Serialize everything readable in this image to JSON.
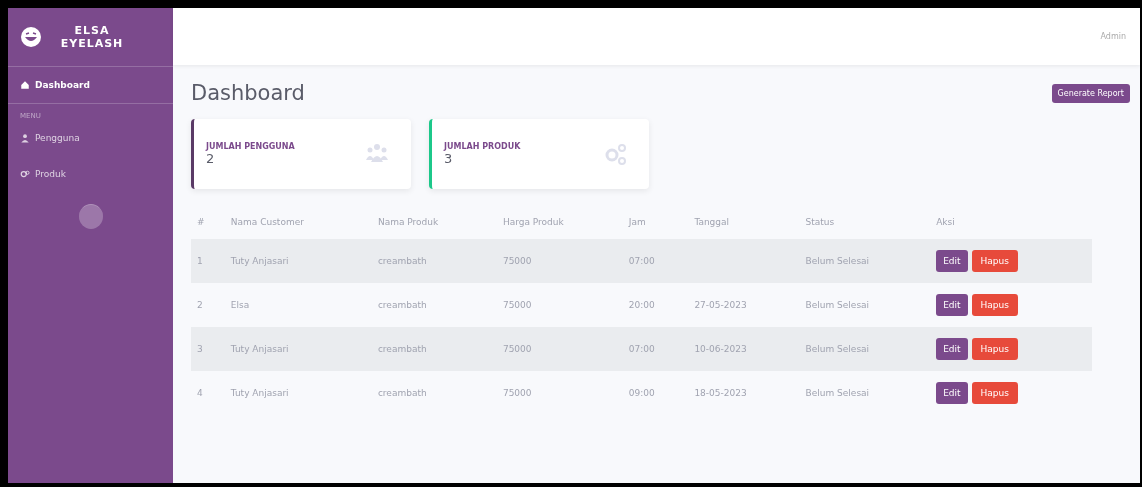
{
  "sidebar": {
    "brand": "ELSA EYELASH",
    "items": [
      {
        "kind": "link",
        "label": "Dashboard",
        "selected": true
      },
      {
        "kind": "heading",
        "label": "MENU"
      },
      {
        "kind": "link",
        "label": "Pengguna",
        "selected": false
      },
      {
        "kind": "link",
        "label": "Produk",
        "selected": false
      }
    ]
  },
  "topbar": {
    "user": "Admin"
  },
  "page": {
    "title": "Dashboard",
    "report_button": "Generate Report"
  },
  "cards": [
    {
      "label": "JUMLAH PENGGUNA",
      "value": "2",
      "color": "#5a3a66"
    },
    {
      "label": "JUMLAH PRODUK",
      "value": "3",
      "color": "#1cc88a"
    }
  ],
  "table": {
    "columns": [
      "#",
      "Nama Customer",
      "Nama Produk",
      "Harga Produk",
      "Jam",
      "Tanggal",
      "Status",
      "Aksi"
    ],
    "rows": [
      {
        "cells": [
          "1",
          "Tuty Anjasari",
          "creambath",
          "75000",
          "07:00",
          "",
          "Belum Selesai"
        ],
        "actions": [
          "Edit",
          "Hapus"
        ]
      },
      {
        "cells": [
          "2",
          "Elsa",
          "creambath",
          "75000",
          "20:00",
          "27-05-2023",
          "Belum Selesai"
        ],
        "actions": [
          "Edit",
          "Hapus"
        ]
      },
      {
        "cells": [
          "3",
          "Tuty Anjasari",
          "creambath",
          "75000",
          "07:00",
          "10-06-2023",
          "Belum Selesai"
        ],
        "actions": [
          "Edit",
          "Hapus"
        ]
      },
      {
        "cells": [
          "4",
          "Tuty Anjasari",
          "creambath",
          "75000",
          "09:00",
          "18-05-2023",
          "Belum Selesai"
        ],
        "actions": [
          "Edit",
          "Hapus"
        ]
      }
    ]
  }
}
